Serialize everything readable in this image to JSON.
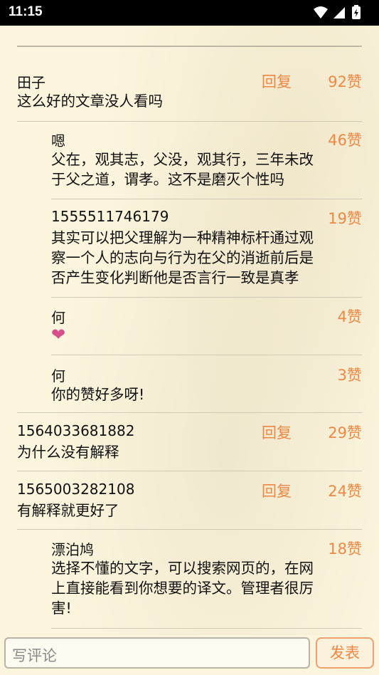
{
  "status": {
    "time": "11:15"
  },
  "comments": [
    {
      "name": "田子",
      "reply": "回复",
      "likes": "92赞",
      "text": [
        "这么好的文章没人看吗"
      ]
    },
    {
      "name": "嗯",
      "likes": "46赞",
      "text": [
        "父在，观其志，父没，观其行，三年未改",
        "于父之道，谓孝。这不是磨灭个性吗"
      ]
    },
    {
      "name": "1555511746179",
      "likes": "19赞",
      "text": [
        "其实可以把父理解为一种精神标杆通过观",
        "察一个人的志向与行为在父的消逝前后是",
        "否产生变化判断他是否言行一致是真孝"
      ]
    },
    {
      "name": "何",
      "likes": "4赞",
      "text": [
        "❤"
      ]
    },
    {
      "name": "何",
      "likes": "3赞",
      "text": [
        "你的赞好多呀!"
      ]
    },
    {
      "name": "1564033681882",
      "reply": "回复",
      "likes": "29赞",
      "text": [
        "为什么没有解释"
      ]
    },
    {
      "name": "1565003282108",
      "reply": "回复",
      "likes": "24赞",
      "text": [
        "有解释就更好了"
      ]
    },
    {
      "name": "漂泊鸠",
      "likes": "18赞",
      "text": [
        "选择不懂的文字，可以搜索网页的，在网",
        "上直接能看到你想要的译文。管理者很厉",
        "害!"
      ]
    }
  ],
  "composer": {
    "placeholder": "写评论",
    "post_label": "发表"
  }
}
